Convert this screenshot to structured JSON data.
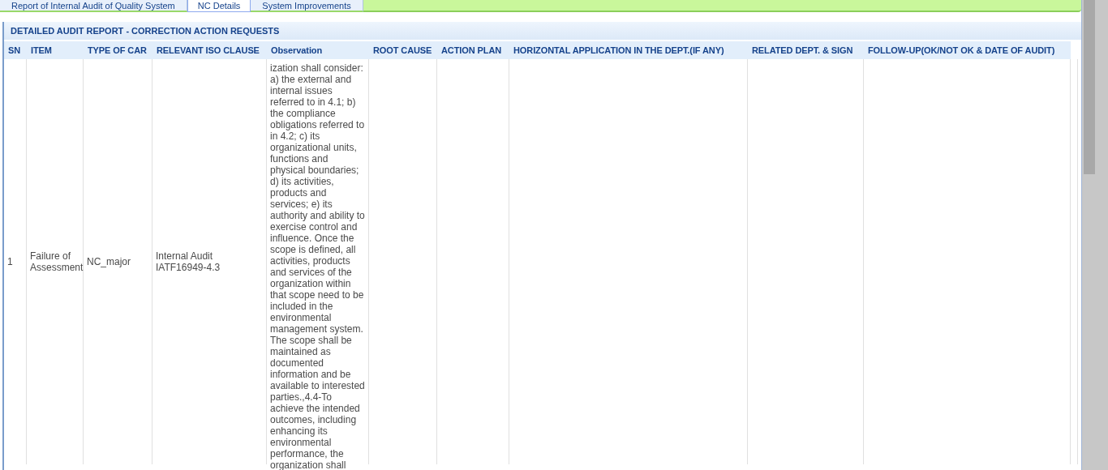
{
  "tabs": [
    {
      "label": "Report of Internal Audit of Quality System",
      "selected": false
    },
    {
      "label": "NC Details",
      "selected": true
    },
    {
      "label": "System Improvements",
      "selected": false
    }
  ],
  "panel": {
    "title": "DETAILED AUDIT REPORT - CORRECTION ACTION REQUESTS"
  },
  "table": {
    "columns": [
      "SN",
      "ITEM",
      "TYPE OF CAR",
      "RELEVANT ISO CLAUSE",
      "Observation",
      "ROOT CAUSE",
      "ACTION PLAN",
      "HORIZONTAL APPLICATION IN THE DEPT.(IF ANY)",
      "RELATED DEPT. & SIGN",
      "FOLLOW-UP(OK/NOT OK & DATE OF AUDIT)"
    ],
    "rows": [
      {
        "cells": [
          "1",
          "Failure of Assessment",
          "NC_major",
          "Internal Audit IATF16949-4.3",
          "ization shall consider: a) the external and internal issues referred to in 4.1; b) the compliance obligations referred to in 4.2; c) its organizational units, functions and physical boundaries; d) its activities, products and services; e) its authority and ability to exercise control and influence. Once the scope is defined, all activities, products and services of the organization within that scope need to be included in the environmental management system. The scope shall be maintained as documented information and be available to interested parties.,4.4-To achieve the intended outcomes, including enhancing its environmental performance, the organization shall",
          "",
          "",
          "",
          "",
          "",
          ""
        ]
      }
    ]
  }
}
